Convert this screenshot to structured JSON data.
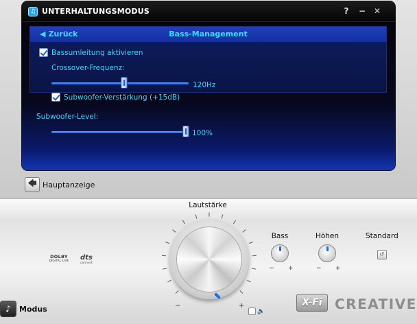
{
  "window": {
    "title": "UNTERHALTUNGSMODUS",
    "help": "?",
    "minimize": "−",
    "close": "✕"
  },
  "section": {
    "back_label": "Zurück",
    "title": "Bass-Management"
  },
  "settings": {
    "bass_redirect_label": "Bassumleitung aktivieren",
    "bass_redirect_checked": true,
    "crossover_label": "Crossover-Frequenz:",
    "crossover_value": "120Hz",
    "crossover_fraction": 0.53,
    "subwoofer_boost_label": "Subwoofer-Verstärkung (+15dB)",
    "subwoofer_boost_checked": true,
    "subwoofer_level_label": "Subwoofer-Level:",
    "subwoofer_level_value": "100%",
    "subwoofer_level_fraction": 1.0
  },
  "nav": {
    "main_display_label": "Hauptanzeige"
  },
  "controls": {
    "volume_label": "Lautstärke",
    "bass_label": "Bass",
    "treble_label": "Höhen",
    "standard_label": "Standard",
    "minus": "−",
    "plus": "+",
    "mode_label": "Modus"
  },
  "logos": {
    "dolby_line1": "DOLBY",
    "dolby_line2": "DIGITAL LIVE",
    "dts_line1": "dts",
    "dts_line2": "connect",
    "xfi": "X-Fi",
    "creative": "CREATIVE"
  },
  "colors": {
    "accent": "#34e0ff",
    "panel_dark": "#07081c",
    "panel_blue": "#1233b5"
  }
}
